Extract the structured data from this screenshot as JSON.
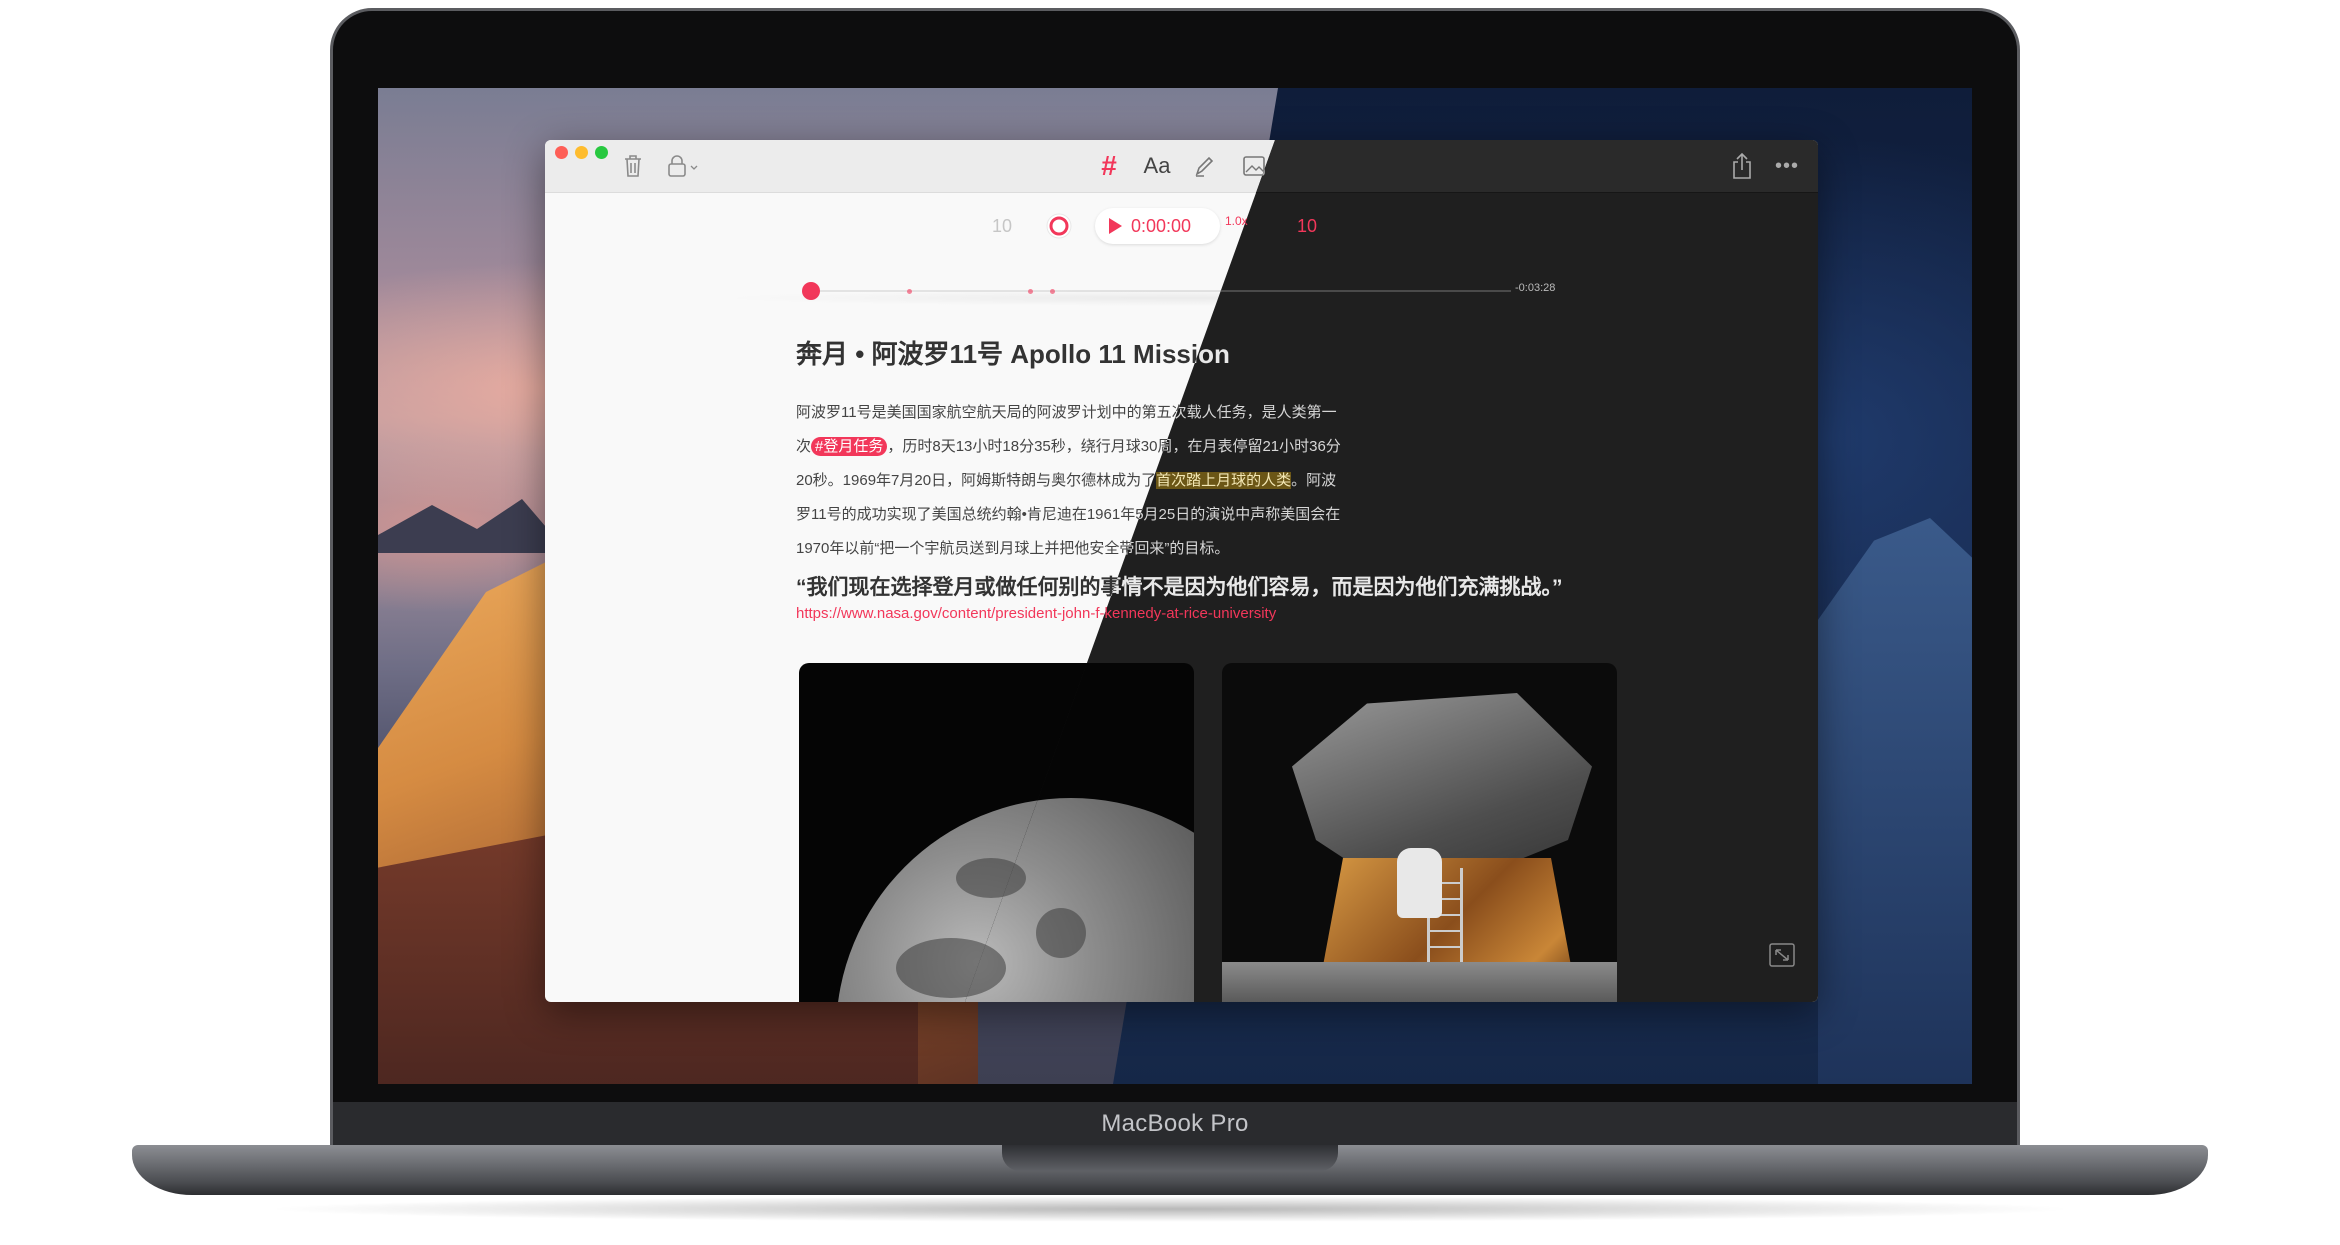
{
  "device": {
    "label": "MacBook Pro"
  },
  "toolbar": {
    "hashtag_glyph": "#",
    "font_glyph": "Aa",
    "more_glyph": "•••",
    "icons": [
      "trash-icon",
      "lock-icon",
      "hashtag-icon",
      "font-icon",
      "pen-icon",
      "image-icon",
      "share-icon",
      "more-icon"
    ]
  },
  "player": {
    "back_label": "10",
    "forward_label": "10",
    "time": "0:00:00",
    "speed": "1.0x",
    "remaining": "-0:03:28",
    "progress": 0.0
  },
  "note": {
    "title": "奔月 • 阿波罗11号 Apollo 11 Mission",
    "para_pre": "阿波罗11号是美国国家航空航天局的阿波罗计划中的第五次载人任务，是人类第一次",
    "tag": "#登月任务",
    "para_mid": "，历时8天13小时18分35秒，绕行月球30周，在月表停留21小时36分20秒。1969年7月20日，阿姆斯特朗与奥尔德林成为了",
    "highlight": "首次踏上月球的人类",
    "para_post": "。阿波罗11号的成功实现了美国总统约翰•肯尼迪在1961年5月25日的演说中声称美国会在1970年以前“把一个宇航员送到月球上并把他安全带回来”的目标。",
    "quote": "“我们现在选择登月或做任何别的事情不是因为他们容易，而是因为他们充满挑战。”",
    "link": "https://www.nasa.gov/content/president-john-f-kennedy-at-rice-university"
  },
  "colors": {
    "accent": "#f2375a",
    "light_bg": "#f9f9f9",
    "dark_bg": "#1f1f1f",
    "highlight": "#ffe7a3"
  }
}
